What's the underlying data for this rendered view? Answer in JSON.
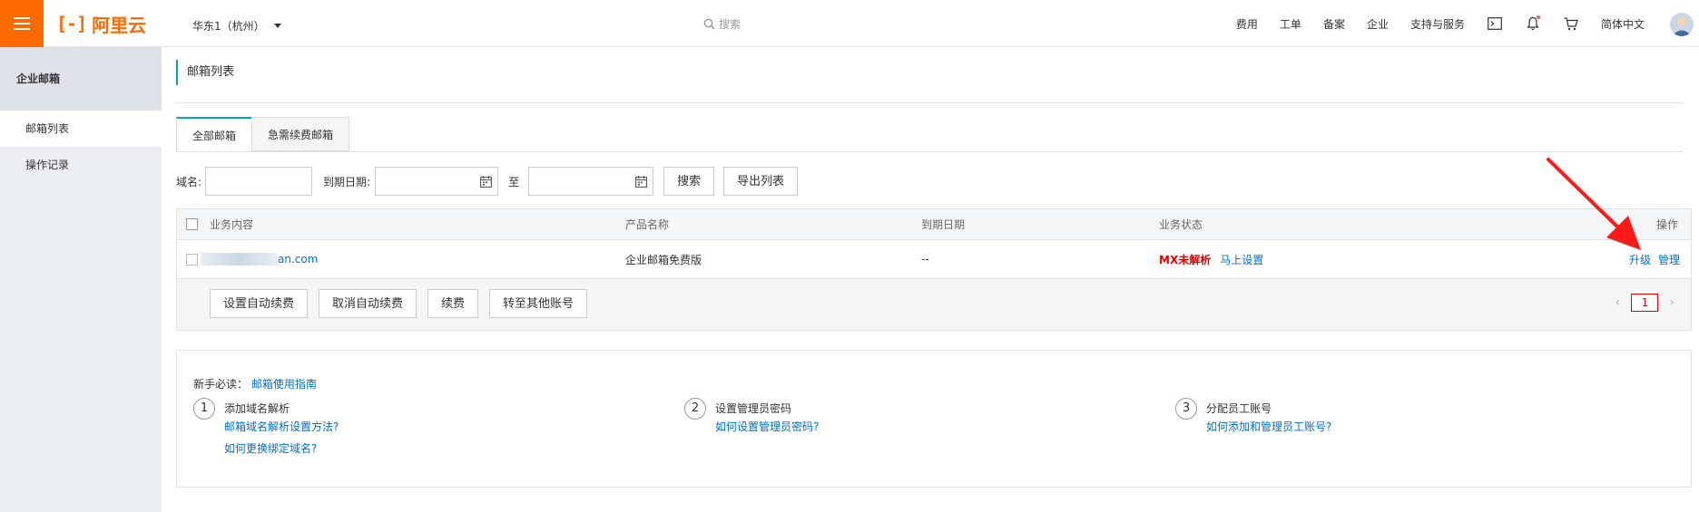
{
  "topbar": {
    "logo_mark": "[-]",
    "logo_text": "阿里云",
    "region": "华东1（杭州）",
    "search_placeholder": "搜索",
    "nav": [
      "费用",
      "工单",
      "备案",
      "企业",
      "支持与服务"
    ],
    "language": "简体中文"
  },
  "sidebar": {
    "title": "企业邮箱",
    "items": [
      {
        "label": "邮箱列表",
        "active": true
      },
      {
        "label": "操作记录",
        "active": false
      }
    ]
  },
  "main": {
    "page_title": "邮箱列表",
    "tabs": [
      {
        "label": "全部邮箱",
        "active": true
      },
      {
        "label": "急需续费邮箱",
        "active": false
      }
    ],
    "filters": {
      "domain_label": "域名:",
      "date_label": "到期日期:",
      "to_label": "至",
      "search_button": "搜索",
      "export_button": "导出列表"
    },
    "table": {
      "columns": [
        "业务内容",
        "产品名称",
        "到期日期",
        "业务状态",
        "操作"
      ],
      "rows": [
        {
          "domain_visible": "an.com",
          "product": "企业邮箱免费版",
          "expiry": "--",
          "status": "MX未解析",
          "status_action": "马上设置",
          "actions": [
            "升级",
            "管理"
          ]
        }
      ],
      "footer_buttons": [
        "设置自动续费",
        "取消自动续费",
        "续费",
        "转至其他账号"
      ],
      "page": "1"
    },
    "guide": {
      "label": "新手必读：",
      "label_link": "邮箱使用指南",
      "steps": [
        {
          "num": "1",
          "title": "添加域名解析",
          "links": [
            "邮箱域名解析设置方法?",
            "如何更换绑定域名?"
          ]
        },
        {
          "num": "2",
          "title": "设置管理员密码",
          "links": [
            "如何设置管理员密码?"
          ]
        },
        {
          "num": "3",
          "title": "分配员工账号",
          "links": [
            "如何添加和管理员工账号?"
          ]
        }
      ]
    }
  },
  "colors": {
    "brand": "#ff6a00",
    "link": "#0070cc",
    "alert": "#e60000",
    "annotation_arrow": "#ff1a1a"
  }
}
